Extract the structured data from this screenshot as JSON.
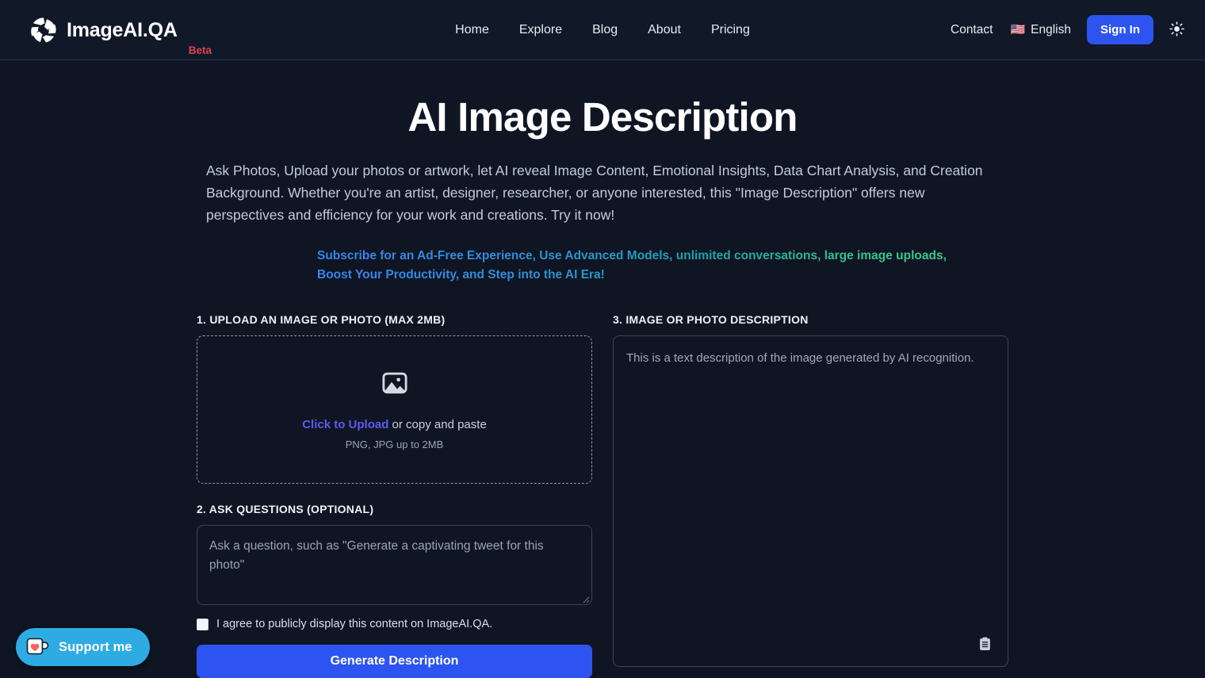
{
  "header": {
    "brand_name": "ImageAI.QA",
    "brand_badge": "Beta",
    "logo_icon": "aperture-icon",
    "nav": [
      {
        "label": "Home"
      },
      {
        "label": "Explore"
      },
      {
        "label": "Blog"
      },
      {
        "label": "About"
      },
      {
        "label": "Pricing"
      }
    ],
    "contact_label": "Contact",
    "language": {
      "flag": "🇺🇸",
      "label": "English"
    },
    "signin_label": "Sign In",
    "theme_toggle_icon": "sun-icon"
  },
  "hero": {
    "title": "AI Image Description",
    "description": "Ask Photos, Upload your photos or artwork, let AI reveal Image Content, Emotional Insights, Data Chart Analysis, and Creation Background. Whether you're an artist, designer, researcher, or anyone interested, this \"Image Description\" offers new perspectives and efficiency for your work and creations. Try it now!",
    "promo": "Subscribe for an Ad-Free Experience, Use Advanced Models, unlimited conversations, large image uploads, Boost Your Productivity, and Step into the AI Era!"
  },
  "upload": {
    "label": "1. UPLOAD AN IMAGE OR PHOTO (MAX 2MB)",
    "icon": "image-placeholder-icon",
    "cta_accent": "Click to Upload",
    "cta_rest": " or copy and paste",
    "hint": "PNG, JPG up to 2MB"
  },
  "question": {
    "label": "2. ASK QUESTIONS (OPTIONAL)",
    "placeholder": "Ask a question, such as \"Generate a captivating tweet for this photo\"",
    "value": "",
    "agree_label": "I agree to publicly display this content on ImageAI.QA.",
    "agree_checked": false,
    "submit_label": "Generate Description"
  },
  "description": {
    "label": "3. IMAGE OR PHOTO DESCRIPTION",
    "placeholder": "This is a text description of the image generated by AI recognition.",
    "value": "",
    "copy_icon": "clipboard-icon"
  },
  "support": {
    "label": "Support me",
    "icon": "coffee-cup-heart-icon"
  },
  "colors": {
    "page_bg": "#0f1523",
    "header_bg": "#111827",
    "accent_blue": "#2d54f0",
    "upload_accent": "#5b5bf0",
    "beta_red": "#e03f56",
    "promo_gradient_start": "#3b82f6",
    "promo_gradient_end": "#3ec98a",
    "support_blue": "#2eabe3",
    "heart_red": "#ff5f5f"
  }
}
